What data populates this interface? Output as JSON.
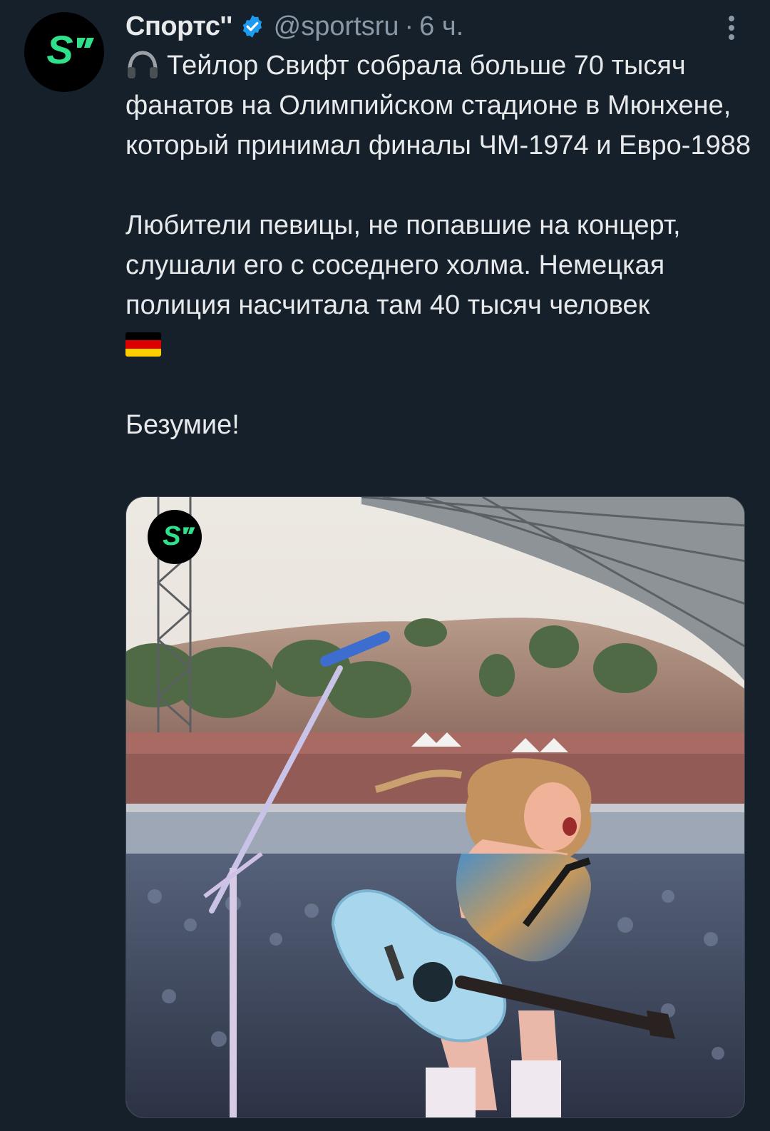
{
  "tweet": {
    "author": {
      "display_name": "Спортс''",
      "handle": "@sportsru",
      "avatar_icon": "sports-logo-icon",
      "verified": true
    },
    "separator": "·",
    "timestamp": "6 ч.",
    "text": {
      "paragraph1": "Тейлор Свифт собрала больше 70 тысяч фанатов на Олимпийском стадионе в Мюнхене, который принимал финалы ЧМ-1974 и Евро-1988",
      "paragraph2": "Любители певицы, не попавшие на концерт, слушали его с соседнего холма. Немецкая полиция насчитала там 40 тысяч человек",
      "paragraph3": "Безумие!"
    },
    "icons": {
      "lead": "headphones-icon",
      "flag": "germany-flag-icon",
      "menu": "more-options-icon"
    },
    "media": {
      "type": "photo",
      "watermark_icon": "sports-logo-icon"
    }
  },
  "colors": {
    "background": "#15202b",
    "text_primary": "#e7e9ea",
    "text_secondary": "#8b98a5",
    "verified": "#1d9bf0",
    "brand_green": "#2fe18a"
  }
}
